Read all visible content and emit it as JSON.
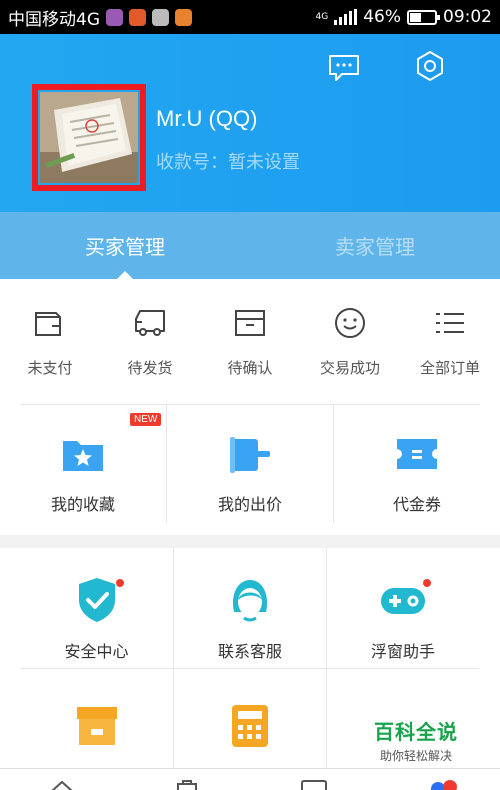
{
  "status_bar": {
    "carrier": "中国移动4G",
    "network": "4G",
    "battery": "46%",
    "battery_level": 0.46,
    "time": "09:02"
  },
  "header": {
    "user_name": "Mr.U (QQ)",
    "account_label": "收款号：",
    "account_value": "暂未设置",
    "icons": [
      "message-icon",
      "settings-icon"
    ],
    "bg_color": "#1ea3f0"
  },
  "tabs": [
    {
      "label": "买家管理",
      "active": true
    },
    {
      "label": "卖家管理",
      "active": false
    }
  ],
  "orders": [
    {
      "label": "未支付",
      "icon": "wallet-icon"
    },
    {
      "label": "待发货",
      "icon": "truck-icon"
    },
    {
      "label": "待确认",
      "icon": "box-icon"
    },
    {
      "label": "交易成功",
      "icon": "smile-icon"
    },
    {
      "label": "全部订单",
      "icon": "list-icon"
    }
  ],
  "favorites": [
    {
      "label": "我的收藏",
      "icon": "star-folder-icon",
      "badge": "NEW"
    },
    {
      "label": "我的出价",
      "icon": "gavel-icon"
    },
    {
      "label": "代金券",
      "icon": "coupon-icon"
    }
  ],
  "services": [
    {
      "label": "安全中心",
      "icon": "shield-check-icon",
      "dot": true
    },
    {
      "label": "联系客服",
      "icon": "customer-service-icon",
      "dot": false
    },
    {
      "label": "浮窗助手",
      "icon": "gamepad-icon",
      "dot": true
    },
    {
      "label": "",
      "icon": "store-icon"
    },
    {
      "label": "",
      "icon": "calculator-icon"
    },
    {
      "label": "",
      "icon": ""
    }
  ],
  "watermark": {
    "title": "百科全说",
    "subtitle": "助你轻松解决"
  },
  "accent_color": "#2c9cf0"
}
